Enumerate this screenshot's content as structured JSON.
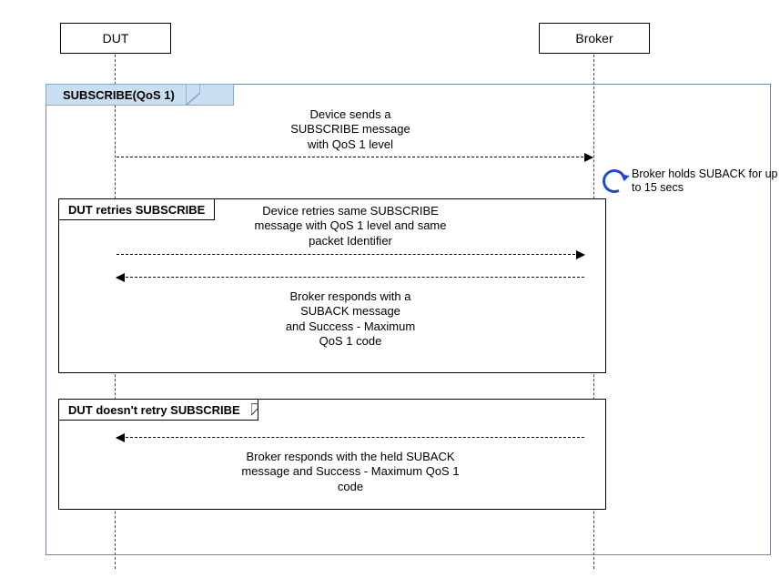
{
  "participants": {
    "dut": "DUT",
    "broker": "Broker"
  },
  "frame_main": {
    "title": "SUBSCRIBE(QoS 1)"
  },
  "msg_initial": "Device sends a\nSUBSCRIBE message\nwith QoS 1 level",
  "hold_note": "Broker holds SUBACK\nfor up to 15 secs",
  "retry_frame": {
    "title": "DUT retries SUBSCRIBE",
    "send_msg": "Device retries same SUBSCRIBE\nmessage with QoS 1 level and same\npacket Identifier",
    "resp_msg": "Broker responds with a\nSUBACK message\nand Success - Maximum\nQoS 1  code"
  },
  "noretry_frame": {
    "title": "DUT doesn't retry SUBSCRIBE",
    "resp_msg": "Broker responds with the held SUBACK\nmessage and Success - Maximum QoS 1\ncode"
  },
  "chart_data": {
    "type": "sequence-diagram",
    "participants": [
      "DUT",
      "Broker"
    ],
    "fragments": [
      {
        "label": "SUBSCRIBE(QoS 1)",
        "events": [
          {
            "kind": "message",
            "from": "DUT",
            "to": "Broker",
            "async": true,
            "text": "Device sends a SUBSCRIBE message with QoS 1 level"
          },
          {
            "kind": "note",
            "at": "Broker",
            "text": "Broker holds SUBACK for up to 15 secs"
          },
          {
            "kind": "fragment",
            "label": "DUT retries SUBSCRIBE",
            "events": [
              {
                "kind": "message",
                "from": "DUT",
                "to": "Broker",
                "async": true,
                "text": "Device retries same SUBSCRIBE message with QoS 1 level and same packet Identifier"
              },
              {
                "kind": "message",
                "from": "Broker",
                "to": "DUT",
                "async": true,
                "text": "Broker responds with a SUBACK message and Success - Maximum QoS 1 code"
              }
            ]
          },
          {
            "kind": "fragment",
            "label": "DUT doesn't retry SUBSCRIBE",
            "events": [
              {
                "kind": "message",
                "from": "Broker",
                "to": "DUT",
                "async": true,
                "text": "Broker responds with the held SUBACK message and Success - Maximum QoS 1 code"
              }
            ]
          }
        ]
      }
    ]
  }
}
